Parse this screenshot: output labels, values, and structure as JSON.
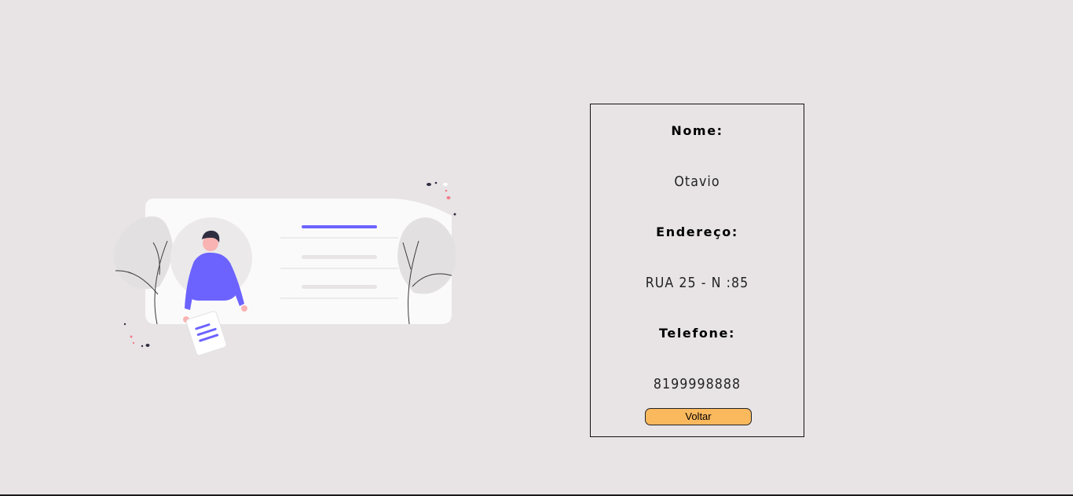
{
  "profile": {
    "name_label": "Nome:",
    "name_value": "Otavio",
    "address_label": "Endereço:",
    "address_value": "RUA 25 - N :85",
    "phone_label": "Telefone:",
    "phone_value": "8199998888",
    "back_button_label": "Voltar"
  },
  "colors": {
    "background": "#e8e4e5",
    "accent": "#6c63ff",
    "button": "#fbb95e"
  },
  "illustration": {
    "icon": "profile-card-illustration"
  }
}
